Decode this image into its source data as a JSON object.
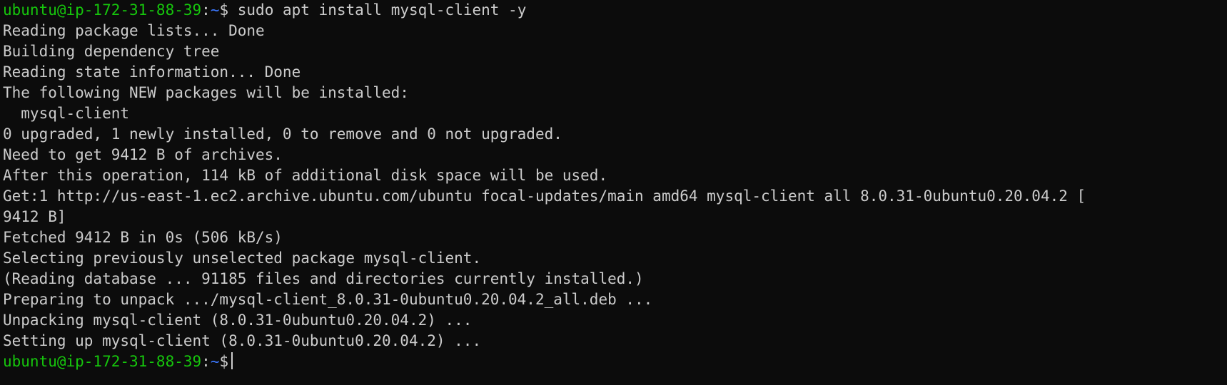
{
  "prompt": {
    "user_host": "ubuntu@ip-172-31-88-39",
    "separator": ":",
    "path": "~",
    "symbol": "$"
  },
  "command": " sudo apt install mysql-client -y",
  "output_lines": [
    "Reading package lists... Done",
    "Building dependency tree",
    "Reading state information... Done",
    "The following NEW packages will be installed:",
    "  mysql-client",
    "0 upgraded, 1 newly installed, 0 to remove and 0 not upgraded.",
    "Need to get 9412 B of archives.",
    "After this operation, 114 kB of additional disk space will be used.",
    "Get:1 http://us-east-1.ec2.archive.ubuntu.com/ubuntu focal-updates/main amd64 mysql-client all 8.0.31-0ubuntu0.20.04.2 [",
    "9412 B]",
    "Fetched 9412 B in 0s (506 kB/s)",
    "Selecting previously unselected package mysql-client.",
    "(Reading database ... 91185 files and directories currently installed.)",
    "Preparing to unpack .../mysql-client_8.0.31-0ubuntu0.20.04.2_all.deb ...",
    "Unpacking mysql-client (8.0.31-0ubuntu0.20.04.2) ...",
    "Setting up mysql-client (8.0.31-0ubuntu0.20.04.2) ..."
  ],
  "colors": {
    "background": "#0c0c0c",
    "text": "#cccccc",
    "user_host": "#16c60c",
    "path": "#3b78ff"
  }
}
